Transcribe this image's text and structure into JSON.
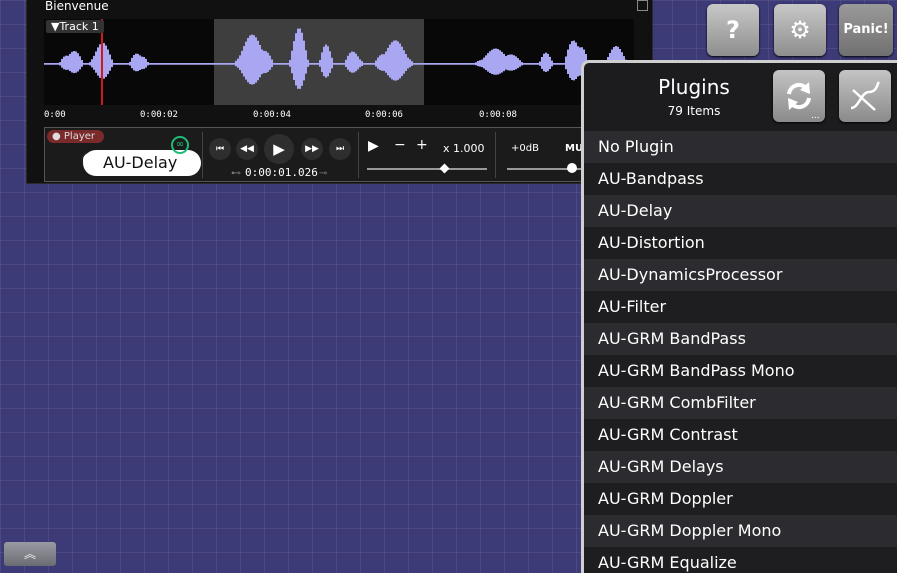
{
  "window": {
    "title": "Bienvenue",
    "track_label": "▼Track 1",
    "ruler_ticks": [
      "0:00",
      "0:00:02",
      "0:00:04",
      "0:00:06",
      "0:00:08"
    ]
  },
  "transport": {
    "player_label": "● Player",
    "plugin_name": "AU-Delay",
    "time": "0:00:01.026",
    "speed": "x 1.000",
    "gain": "+0dB",
    "mute_partial": "MU"
  },
  "toolbar": {
    "help_label": "?",
    "settings_label": "⚙",
    "panic_label": "Panic!"
  },
  "plugins": {
    "title": "Plugins",
    "count": "79 Items",
    "items": [
      "No Plugin",
      "AU-Bandpass",
      "AU-Delay",
      "AU-Distortion",
      "AU-DynamicsProcessor",
      "AU-Filter",
      "AU-GRM BandPass",
      "AU-GRM BandPass Mono",
      "AU-GRM CombFilter",
      "AU-GRM Contrast",
      "AU-GRM Delays",
      "AU-GRM Doppler",
      "AU-GRM Doppler Mono",
      "AU-GRM Equalize"
    ]
  },
  "colors": {
    "background": "#3d3a78",
    "waveform": "#a9a6f2",
    "playhead": "#d01818",
    "accent_green": "#1dbb77"
  },
  "icons": {
    "refresh": "refresh-icon",
    "curve": "curve-icon",
    "expand_up": "double-chevron-up-icon"
  }
}
